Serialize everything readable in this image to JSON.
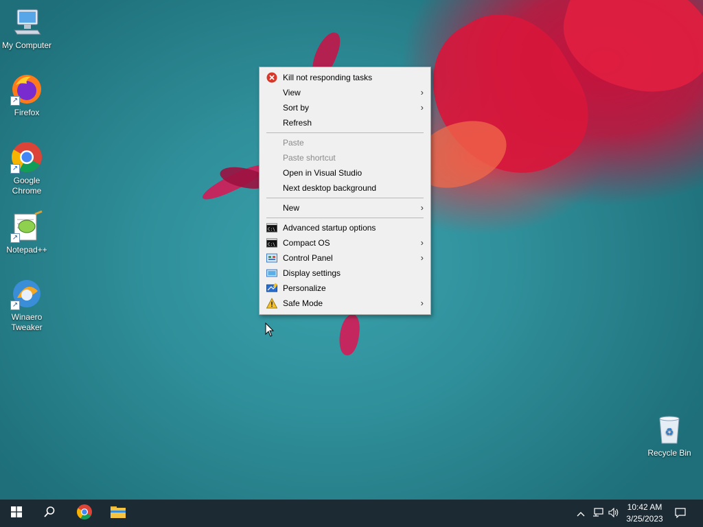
{
  "desktop": {
    "icons": [
      {
        "label": "My Computer",
        "icon": "computer-icon"
      },
      {
        "label": "Firefox",
        "icon": "firefox-icon"
      },
      {
        "label": "Google Chrome",
        "icon": "chrome-icon"
      },
      {
        "label": "Notepad++",
        "icon": "notepadpp-icon"
      },
      {
        "label": "Winaero Tweaker",
        "icon": "winaero-tweaker-icon"
      },
      {
        "label": "Recycle Bin",
        "icon": "recycle-bin-icon"
      }
    ]
  },
  "context_menu": {
    "items": [
      {
        "label": "Kill not responding tasks",
        "icon": "error-x-icon"
      },
      {
        "label": "View",
        "submenu": true
      },
      {
        "label": "Sort by",
        "submenu": true
      },
      {
        "label": "Refresh"
      },
      {
        "label": "Paste",
        "disabled": true
      },
      {
        "label": "Paste shortcut",
        "disabled": true
      },
      {
        "label": "Open in Visual Studio"
      },
      {
        "label": "Next desktop background"
      },
      {
        "label": "New",
        "submenu": true
      },
      {
        "label": "Advanced startup options",
        "icon": "cmd-icon"
      },
      {
        "label": "Compact OS",
        "icon": "cmd-icon",
        "submenu": true
      },
      {
        "label": "Control Panel",
        "icon": "control-panel-icon",
        "submenu": true
      },
      {
        "label": "Display settings",
        "icon": "display-icon"
      },
      {
        "label": "Personalize",
        "icon": "personalize-icon"
      },
      {
        "label": "Safe Mode",
        "icon": "warning-icon",
        "submenu": true
      }
    ],
    "chevron": "›"
  },
  "taskbar": {
    "time": "10:42 AM",
    "date": "3/25/2023",
    "pinned": [
      "start-icon",
      "search-icon",
      "chrome-icon",
      "file-explorer-icon"
    ]
  },
  "colors": {
    "taskbar_bg": "#1c2a33",
    "menu_bg": "#f0f0f0",
    "disabled_text": "#8a8a8a"
  }
}
